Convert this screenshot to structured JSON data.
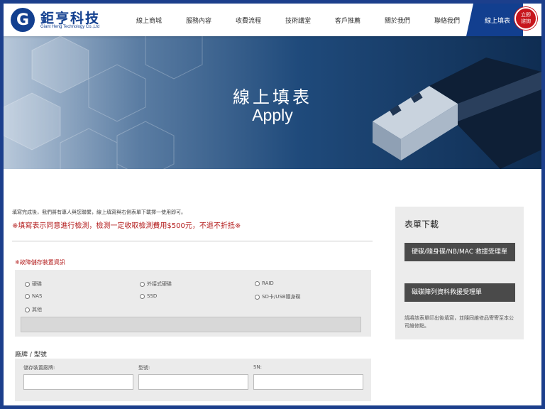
{
  "brand": {
    "name_cn": "鉅亨科技",
    "name_en": "Giant Heng Technology Co.,Ltd",
    "logo_letter": "G"
  },
  "nav": {
    "items": [
      "線上商城",
      "服務內容",
      "收費流程",
      "技術講堂",
      "客戶推薦",
      "關於我們",
      "聯絡我們"
    ],
    "active": "線上填表",
    "cta_line1": "立即",
    "cta_line2": "諮詢"
  },
  "banner": {
    "title": "線上填表",
    "subtitle": "Apply"
  },
  "intro": {
    "text": "填寫完成後，我們將有專人與您聯繫，線上填寫與右側表單下載擇一使用即可。",
    "notice": "※填寫表示同意進行檢測，檢測一定收取檢測費用$500元，不退不折抵※"
  },
  "device_section": {
    "title": "※故障儲存裝置資訊",
    "options": [
      "硬碟",
      "外接式硬碟",
      "RAID",
      "NAS",
      "SSD",
      "SD卡/USB隨身碟",
      "其他"
    ],
    "other_value": ""
  },
  "brand_section": {
    "title": "廠牌 / 型號",
    "fields": [
      {
        "label": "儲存裝置廠牌:",
        "value": ""
      },
      {
        "label": "型號:",
        "value": ""
      },
      {
        "label": "SN:",
        "value": ""
      }
    ]
  },
  "download": {
    "title": "表單下載",
    "buttons": [
      "硬碟/隨身碟/NB/MAC 救援受理單",
      "磁碟陣列資料救援受理單"
    ],
    "note": "請將該表單印出後填寫，並隨同維修品寄寄至本公司維修點。"
  },
  "colors": {
    "brand_blue": "#123f8f",
    "cta_red": "#c7161c",
    "notice_red": "#b31b1b",
    "frame_blue": "#1c3f8c"
  }
}
